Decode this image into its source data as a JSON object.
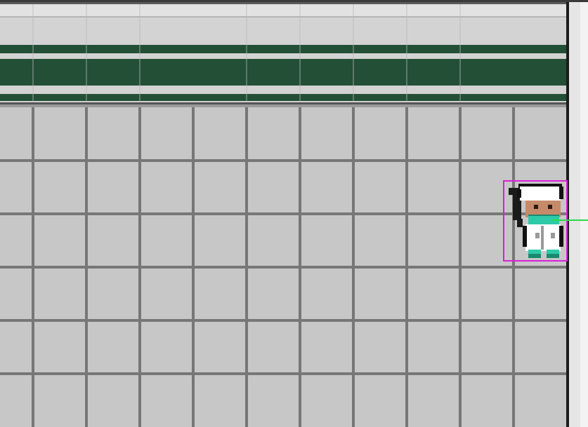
{
  "scene": {
    "type": "top-down pixel-art game view",
    "floor": {
      "rows": 6,
      "cols": 11,
      "tile_color": "#c7c7c7",
      "grout_color": "#777777"
    },
    "wall": {
      "stripe_color": "#234f37",
      "panel_color": "#d3d3d3",
      "top_border_color": "#2a2a2a"
    },
    "right_border_color": "#1c1c1c"
  },
  "character": {
    "name": "nurse",
    "outfit_color": "#ffffff",
    "mask_color": "#2ec9a8",
    "skin_color": "#c58a6a",
    "hair_color": "#1a1a1a",
    "selection_box_color": "#d81fd8",
    "direction_line_color": "#2bd94a",
    "facing": "right"
  }
}
